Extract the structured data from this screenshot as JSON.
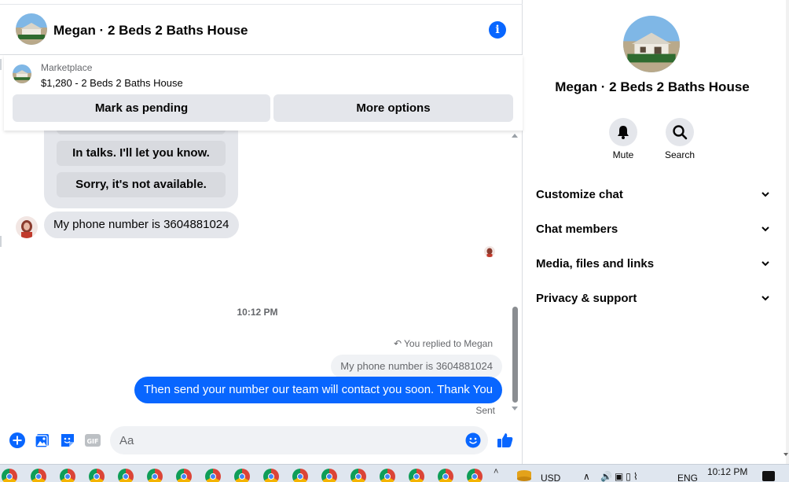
{
  "conversation": {
    "title": "Megan · 2 Beds 2 Baths House",
    "info_icon": "info-icon"
  },
  "marketplace": {
    "label": "Marketplace",
    "listing": "$1,280 - 2 Beds 2 Baths House",
    "mark_pending_label": "Mark as pending",
    "more_options_label": "More options"
  },
  "messages": {
    "quick_replies": [
      "In talks. I'll let you know.",
      "Sorry, it's not available."
    ],
    "incoming_text": "My phone number is 3604881024",
    "timestamp": "10:12 PM",
    "replied_label": "You replied to Megan",
    "quoted_text": "My phone number is 3604881024",
    "outgoing_text": "Then send your number our team will contact you soon. Thank You",
    "status": "Sent"
  },
  "composer": {
    "placeholder": "Aa",
    "value": ""
  },
  "info_panel": {
    "title": "Megan · 2 Beds 2 Baths House",
    "actions": [
      {
        "label": "Mute",
        "icon": "bell-icon"
      },
      {
        "label": "Search",
        "icon": "search-icon"
      }
    ],
    "sections": [
      "Customize chat",
      "Chat members",
      "Media, files and links",
      "Privacy & support"
    ]
  },
  "taskbar": {
    "currency": "USD",
    "language": "ENG",
    "time": "10:12 PM"
  },
  "colors": {
    "accent": "#0866ff",
    "bubble_gray": "#e4e6eb",
    "secondary_text": "#65676b"
  }
}
